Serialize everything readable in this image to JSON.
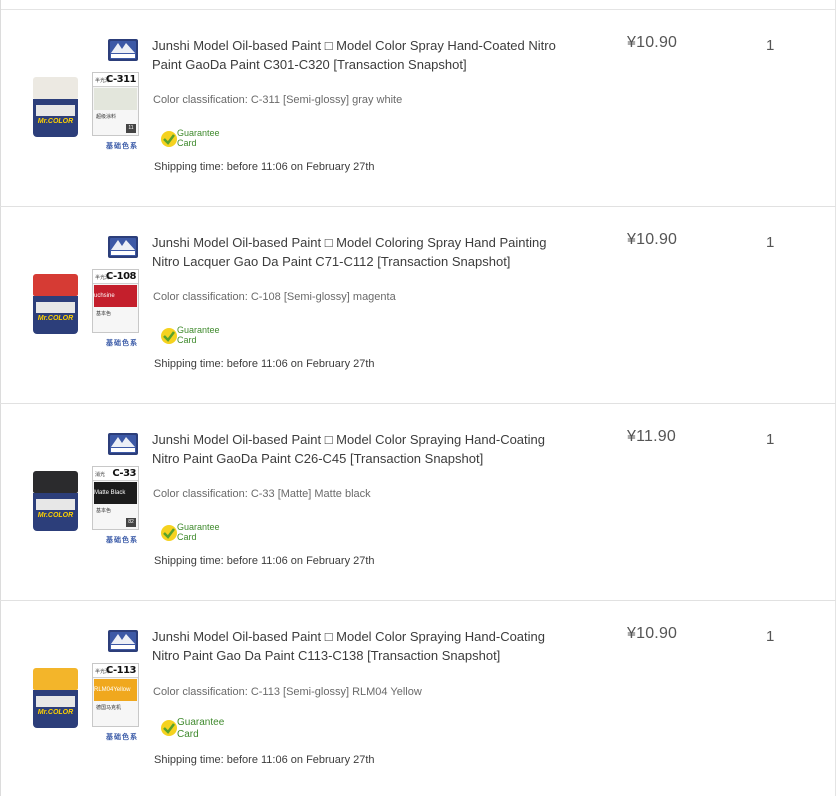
{
  "order_items": [
    {
      "title": "Junshi Model Oil-based Paint □ Model Color Spray Hand-Coated Nitro Paint GaoDa Paint C301-C320 [Transaction Snapshot]",
      "sku": "Color classification: C-311 [Semi-glossy] gray white",
      "guarantee": "Guarantee Card",
      "shipping": "Shipping time: before 11:06 on February 27th",
      "price": "¥10.90",
      "quantity": "1",
      "paint_code": "C-311",
      "swatch_label": "",
      "cap_color": "#ece9e2",
      "swatch_color": "#e3e6dc"
    },
    {
      "title": "Junshi Model Oil-based Paint □ Model Coloring Spray Hand Painting Nitro Lacquer Gao Da Paint C71-C112 [Transaction Snapshot]",
      "sku": "Color classification: C-108 [Semi-glossy] magenta",
      "guarantee": "Guarantee Card",
      "shipping": "Shipping time: before 11:06 on February 27th",
      "price": "¥10.90",
      "quantity": "1",
      "paint_code": "C-108",
      "swatch_label": "uchsine",
      "cap_color": "#d63b34",
      "swatch_color": "#c41f2c"
    },
    {
      "title": "Junshi Model Oil-based Paint □ Model Color Spraying Hand-Coating Nitro Paint GaoDa Paint C26-C45 [Transaction Snapshot]",
      "sku": "Color classification: C-33 [Matte] Matte black",
      "guarantee": "Guarantee Card",
      "shipping": "Shipping time: before 11:06 on February 27th",
      "price": "¥11.90",
      "quantity": "1",
      "paint_code": "C-33",
      "swatch_label": "Matte Black",
      "cap_color": "#2b2b2d",
      "swatch_color": "#1c1c1c"
    },
    {
      "title": "Junshi Model Oil-based Paint □ Model Color Spraying Hand-Coating Nitro Paint Gao Da Paint C113-C138 [Transaction Snapshot]",
      "sku": "Color classification: C-113 [Semi-glossy] RLM04 Yellow",
      "guarantee": "Guarantee Card",
      "shipping": "Shipping time: before 11:06 on February 27th",
      "price": "¥10.90",
      "quantity": "1",
      "paint_code": "C-113",
      "swatch_label": "RLM04Yellow",
      "cap_color": "#f3b52a",
      "swatch_color": "#f0a81e"
    }
  ],
  "icons": {
    "brand_logo": "mr-hobby-logo-icon",
    "guarantee": "guarantee-shield-icon"
  },
  "colors": {
    "guarantee_text": "#3f8a2d",
    "brand_blue": "#2c3e7a"
  }
}
